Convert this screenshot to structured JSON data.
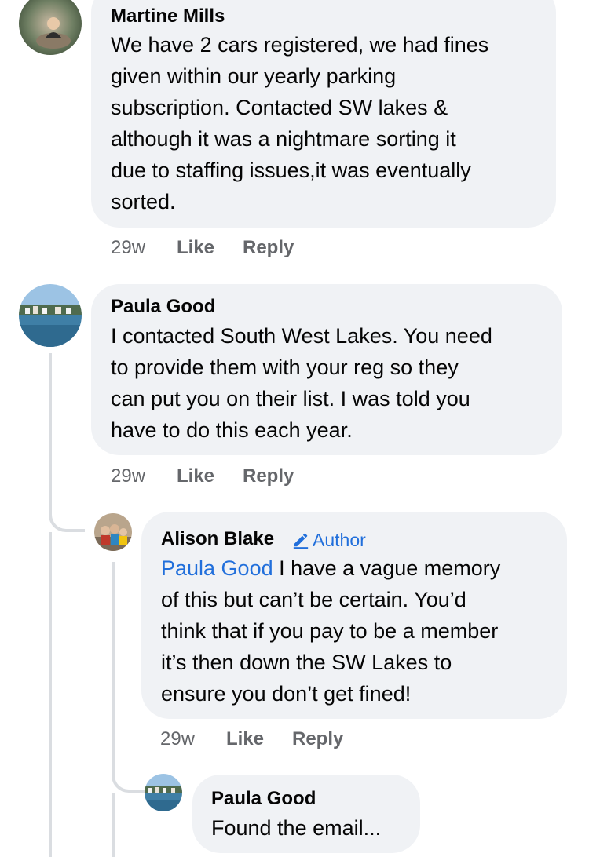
{
  "comments": [
    {
      "name": "Martine Mills",
      "lines": [
        "We have 2 cars registered, we had fines",
        "given within our yearly parking",
        "subscription. Contacted SW lakes &",
        "although it was a nightmare sorting it",
        "due to staffing issues,it was eventually",
        "sorted."
      ],
      "time": "29w",
      "like": "Like",
      "reply": "Reply"
    },
    {
      "name": "Paula Good",
      "lines": [
        "I contacted South West Lakes. You need",
        "to provide them with your reg so they",
        "can put you on their list. I was told you",
        "have to do this each year."
      ],
      "time": "29w",
      "like": "Like",
      "reply": "Reply"
    },
    {
      "name": "Alison Blake",
      "badge": "Author",
      "mention": "Paula Good",
      "first_line_rest": " I have a vague memory",
      "lines": [
        "of this but can’t be certain. You’d",
        "think that if you pay to be a member",
        "it’s then down the SW Lakes to",
        "ensure you don’t get fined!"
      ],
      "time": "29w",
      "like": "Like",
      "reply": "Reply"
    },
    {
      "name": "Paula Good",
      "lines": [
        "Found the email..."
      ]
    }
  ],
  "colors": {
    "bubble": "#f0f2f5",
    "link": "#216fdb",
    "meta": "#65676b",
    "thread": "#dadde1"
  },
  "icons": {
    "author_badge": "pencil-icon"
  }
}
